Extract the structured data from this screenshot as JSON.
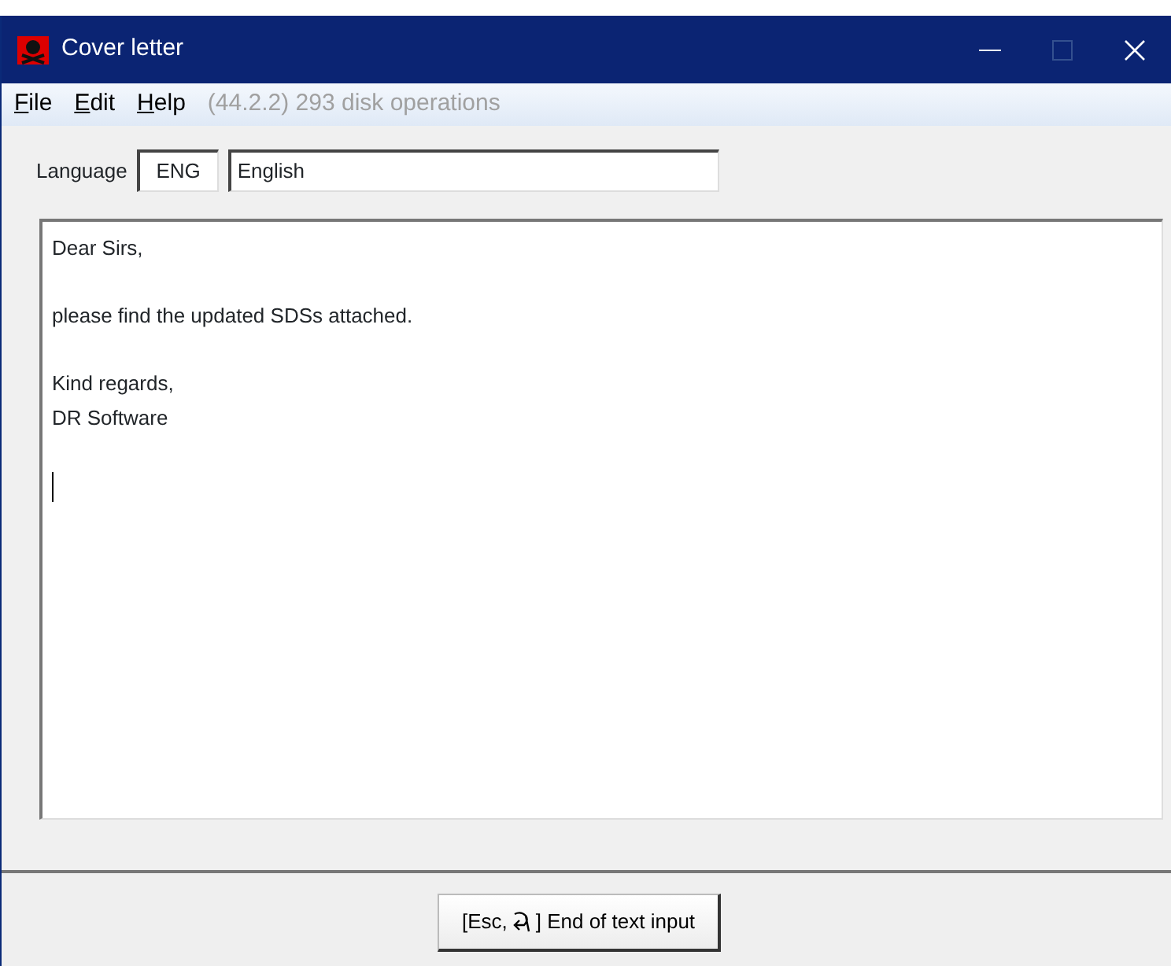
{
  "window": {
    "title": "Cover letter"
  },
  "menu": [
    {
      "label": "File"
    },
    {
      "label": "Edit"
    },
    {
      "label": "Help"
    }
  ],
  "status": "(44.2.2) 293 disk operations",
  "language": {
    "label": "Language",
    "code": "ENG",
    "name": "English"
  },
  "letter": {
    "paragraphs": [
      [
        "Dear Sirs,"
      ],
      [
        "please find the updated SDSs attached."
      ],
      [
        "Kind regards,",
        "DR Software"
      ]
    ]
  },
  "end_button": {
    "before": "[Esc,",
    "after": "] End of text input"
  }
}
